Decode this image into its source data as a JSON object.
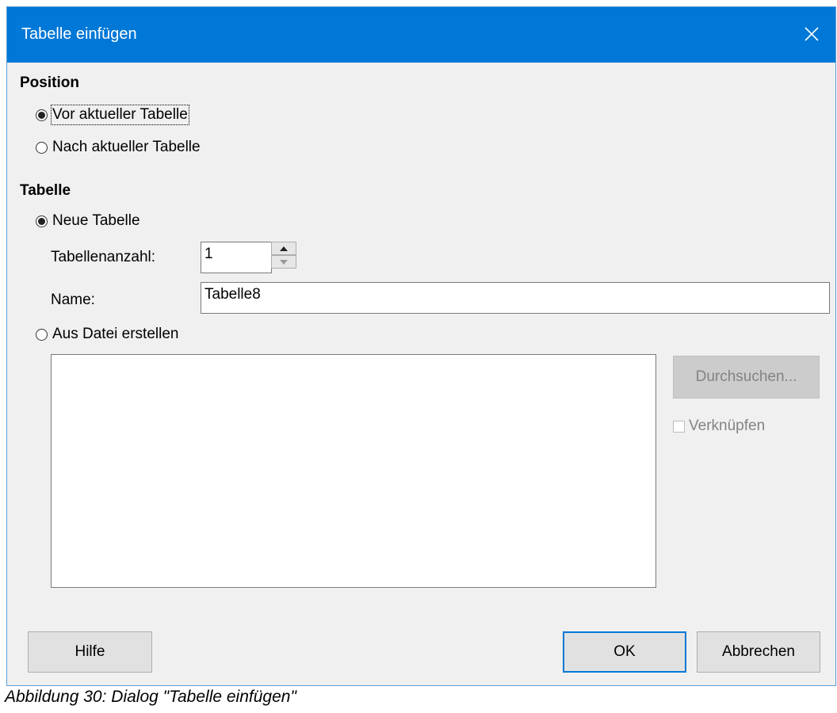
{
  "dialog": {
    "title": "Tabelle einfügen"
  },
  "position": {
    "heading": "Position",
    "options": [
      {
        "label": "Vor aktueller Tabelle",
        "checked": true
      },
      {
        "label": "Nach aktueller Tabelle",
        "checked": false
      }
    ]
  },
  "tabelle": {
    "heading": "Tabelle",
    "new_table_label": "Neue Tabelle",
    "new_table_checked": true,
    "count_label": "Tabellenanzahl:",
    "count_value": "1",
    "name_label": "Name:",
    "name_value": "Tabelle8",
    "from_file_label": "Aus Datei erstellen",
    "from_file_checked": false,
    "browse_label": "Durchsuchen...",
    "link_label": "Verknüpfen",
    "link_checked": false
  },
  "buttons": {
    "help": "Hilfe",
    "ok": "OK",
    "cancel": "Abbrechen"
  },
  "caption": "Abbildung 30: Dialog \"Tabelle einfügen\""
}
